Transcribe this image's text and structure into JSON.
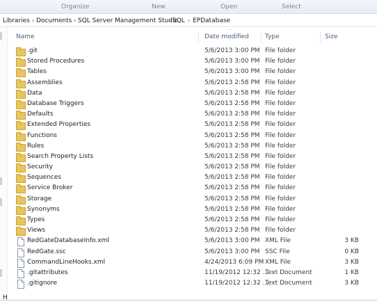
{
  "toolbar": {
    "organize": "Organize",
    "new": "New",
    "open": "Open",
    "select": "Select"
  },
  "breadcrumb": [
    "Libraries",
    "Documents",
    "SQL Server Management Studio",
    "SQL",
    "EPDatabase"
  ],
  "columns": {
    "name": "Name",
    "date": "Date modified",
    "type": "Type",
    "size": "Size"
  },
  "rows": [
    {
      "name": ".git",
      "date": "5/6/2013 3:00 PM",
      "type": "File folder",
      "size": "",
      "icon": "folder-icon"
    },
    {
      "name": "Stored Procedures",
      "date": "5/6/2013 3:00 PM",
      "type": "File folder",
      "size": "",
      "icon": "folder-icon"
    },
    {
      "name": "Tables",
      "date": "5/6/2013 3:00 PM",
      "type": "File folder",
      "size": "",
      "icon": "folder-icon"
    },
    {
      "name": "Assemblies",
      "date": "5/6/2013 2:58 PM",
      "type": "File folder",
      "size": "",
      "icon": "folder-icon"
    },
    {
      "name": "Data",
      "date": "5/6/2013 2:58 PM",
      "type": "File folder",
      "size": "",
      "icon": "folder-icon"
    },
    {
      "name": "Database Triggers",
      "date": "5/6/2013 2:58 PM",
      "type": "File folder",
      "size": "",
      "icon": "folder-icon"
    },
    {
      "name": "Defaults",
      "date": "5/6/2013 2:58 PM",
      "type": "File folder",
      "size": "",
      "icon": "folder-icon"
    },
    {
      "name": "Extended Properties",
      "date": "5/6/2013 2:58 PM",
      "type": "File folder",
      "size": "",
      "icon": "folder-icon"
    },
    {
      "name": "Functions",
      "date": "5/6/2013 2:58 PM",
      "type": "File folder",
      "size": "",
      "icon": "folder-icon"
    },
    {
      "name": "Rules",
      "date": "5/6/2013 2:58 PM",
      "type": "File folder",
      "size": "",
      "icon": "folder-icon"
    },
    {
      "name": "Search Property Lists",
      "date": "5/6/2013 2:58 PM",
      "type": "File folder",
      "size": "",
      "icon": "folder-icon"
    },
    {
      "name": "Security",
      "date": "5/6/2013 2:58 PM",
      "type": "File folder",
      "size": "",
      "icon": "folder-icon"
    },
    {
      "name": "Sequences",
      "date": "5/6/2013 2:58 PM",
      "type": "File folder",
      "size": "",
      "icon": "folder-icon"
    },
    {
      "name": "Service Broker",
      "date": "5/6/2013 2:58 PM",
      "type": "File folder",
      "size": "",
      "icon": "folder-icon"
    },
    {
      "name": "Storage",
      "date": "5/6/2013 2:58 PM",
      "type": "File folder",
      "size": "",
      "icon": "folder-icon"
    },
    {
      "name": "Synonyms",
      "date": "5/6/2013 2:58 PM",
      "type": "File folder",
      "size": "",
      "icon": "folder-icon"
    },
    {
      "name": "Types",
      "date": "5/6/2013 2:58 PM",
      "type": "File folder",
      "size": "",
      "icon": "folder-icon"
    },
    {
      "name": "Views",
      "date": "5/6/2013 2:58 PM",
      "type": "File folder",
      "size": "",
      "icon": "folder-icon"
    },
    {
      "name": "RedGateDatabaseInfo.xml",
      "date": "5/6/2013 3:00 PM",
      "type": "XML File",
      "size": "3 KB",
      "icon": "file-icon"
    },
    {
      "name": "RedGate.ssc",
      "date": "5/6/2013 3:00 PM",
      "type": "SSC File",
      "size": "0 KB",
      "icon": "file-icon"
    },
    {
      "name": "CommandLineHooks.xml",
      "date": "4/24/2013 6:09 PM",
      "type": "XML File",
      "size": "3 KB",
      "icon": "file-icon"
    },
    {
      "name": ".gitattributes",
      "date": "11/19/2012 12:32 ...",
      "type": "Text Document",
      "size": "1 KB",
      "icon": "file-icon"
    },
    {
      "name": ".gitignore",
      "date": "11/19/2012 12:32 ...",
      "type": "Text Document",
      "size": "3 KB",
      "icon": "file-icon"
    }
  ],
  "status": {
    "letter": "H"
  },
  "colors": {
    "folder": "#e8c55d",
    "header_text": "#4c607a",
    "toolbar_text": "#7a8796"
  }
}
